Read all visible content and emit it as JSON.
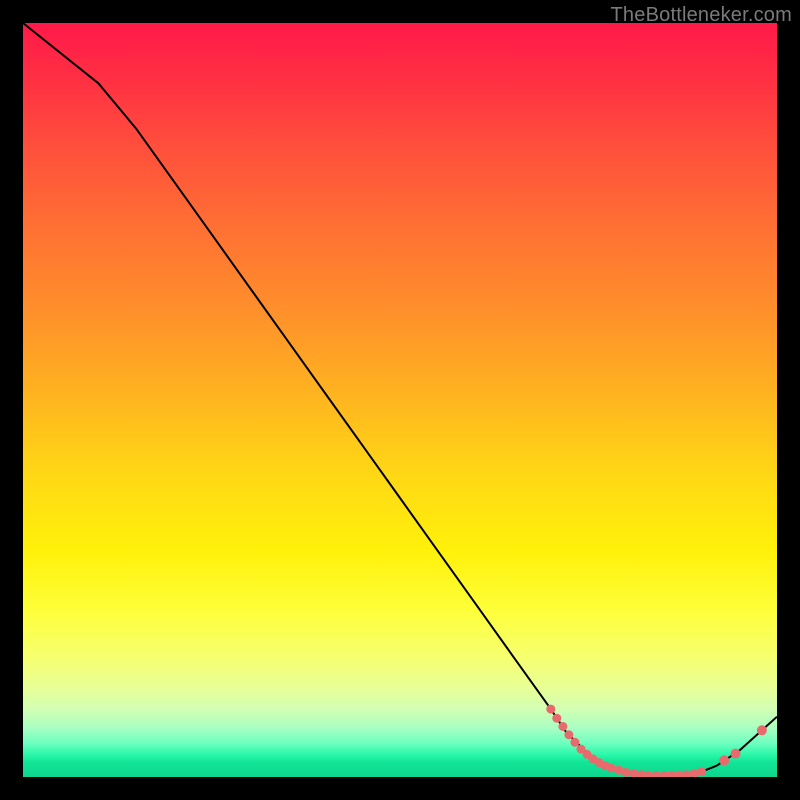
{
  "watermark": "TheBottleneker.com",
  "chart_data": {
    "type": "line",
    "title": "",
    "xlabel": "",
    "ylabel": "",
    "xlim": [
      0,
      100
    ],
    "ylim": [
      0,
      100
    ],
    "grid": false,
    "legend": false,
    "series": [
      {
        "name": "curve",
        "color": "#000000",
        "x": [
          0,
          5,
          10,
          15,
          20,
          25,
          30,
          35,
          40,
          45,
          50,
          55,
          60,
          65,
          70,
          72,
          75,
          78,
          80,
          82,
          85,
          88,
          90,
          92,
          95,
          100
        ],
        "y": [
          100,
          96,
          92,
          86,
          79,
          72,
          65,
          58,
          51,
          44,
          37,
          30,
          23,
          16,
          9,
          6,
          3,
          1.2,
          0.6,
          0.3,
          0.2,
          0.3,
          0.7,
          1.5,
          3.5,
          8
        ]
      }
    ],
    "markers": {
      "color": "#e96a6d",
      "comment": "dense red dots along trough and rising tail",
      "points": [
        {
          "x": 70.0,
          "y": 9.0
        },
        {
          "x": 70.8,
          "y": 7.8
        },
        {
          "x": 71.6,
          "y": 6.7
        },
        {
          "x": 72.4,
          "y": 5.6
        },
        {
          "x": 73.2,
          "y": 4.6
        },
        {
          "x": 74.0,
          "y": 3.7
        },
        {
          "x": 74.8,
          "y": 3.0
        },
        {
          "x": 75.6,
          "y": 2.4
        },
        {
          "x": 76.4,
          "y": 1.9
        },
        {
          "x": 77.2,
          "y": 1.5
        },
        {
          "x": 78.0,
          "y": 1.2
        },
        {
          "x": 79.0,
          "y": 0.9
        },
        {
          "x": 80.0,
          "y": 0.6
        },
        {
          "x": 81.0,
          "y": 0.45
        },
        {
          "x": 82.0,
          "y": 0.3
        },
        {
          "x": 83.0,
          "y": 0.25
        },
        {
          "x": 84.0,
          "y": 0.2
        },
        {
          "x": 85.0,
          "y": 0.2
        },
        {
          "x": 86.0,
          "y": 0.22
        },
        {
          "x": 87.0,
          "y": 0.26
        },
        {
          "x": 88.0,
          "y": 0.3
        },
        {
          "x": 89.0,
          "y": 0.45
        },
        {
          "x": 90.0,
          "y": 0.7
        },
        {
          "x": 93.0,
          "y": 2.2
        },
        {
          "x": 94.5,
          "y": 3.1
        },
        {
          "x": 98.0,
          "y": 6.2
        }
      ]
    },
    "background_gradient": {
      "top": "#ff1a49",
      "mid_upper": "#ff8f2b",
      "mid": "#fff10a",
      "mid_lower": "#d2ffb3",
      "bottom": "#0ed68f"
    }
  }
}
